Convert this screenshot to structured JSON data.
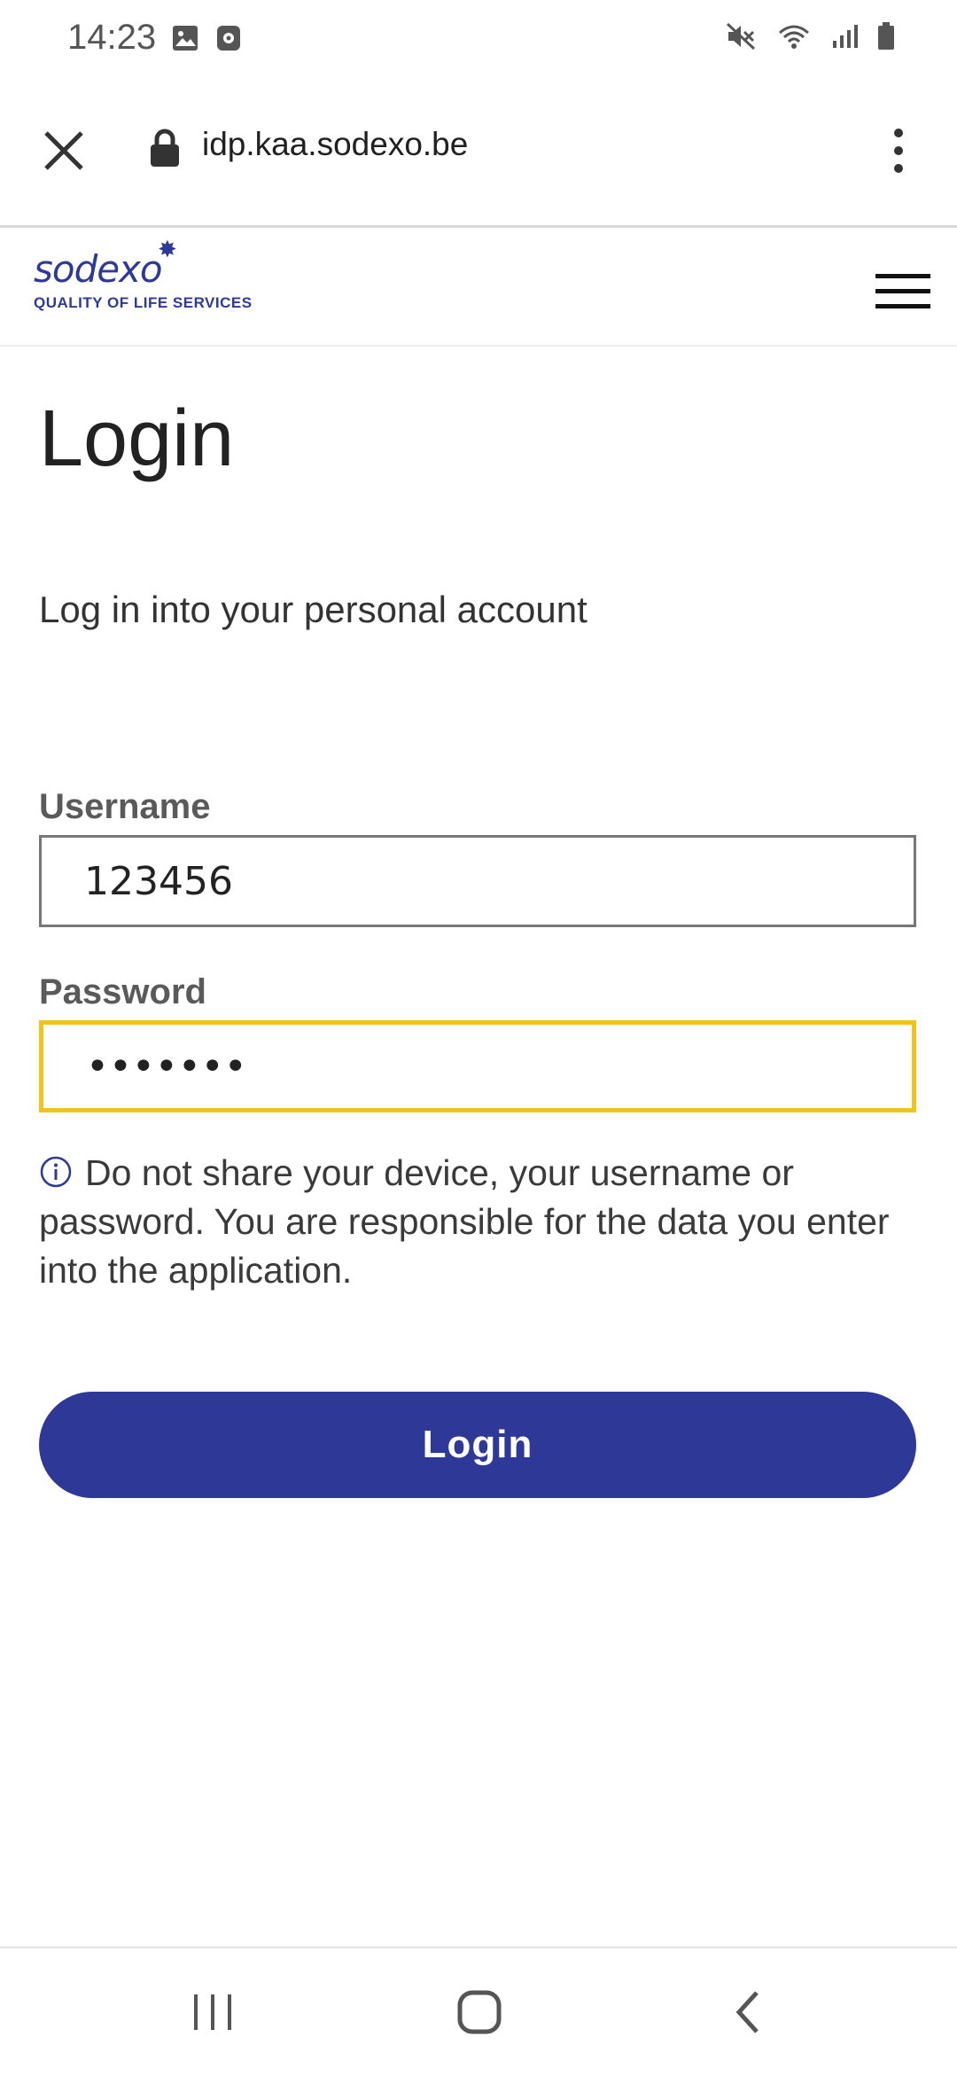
{
  "status_bar": {
    "time": "14:23",
    "left_icons": [
      "image-icon",
      "recorder-icon"
    ],
    "right_icons": [
      "mute-icon",
      "wifi-icon",
      "signal-icon",
      "battery-icon"
    ]
  },
  "browser": {
    "url": "idp.kaa.sodexo.be",
    "icons": [
      "close-icon",
      "lock-icon",
      "more-vert-icon"
    ]
  },
  "site_header": {
    "logo_text": "sodexo",
    "logo_tagline": "QUALITY OF LIFE SERVICES",
    "brand_color": "#2d3a97",
    "menu_icon": "hamburger-icon"
  },
  "login": {
    "title": "Login",
    "subtitle": "Log in into your personal account",
    "username_label": "Username",
    "username_value": "123456",
    "password_label": "Password",
    "password_value": "1234567",
    "notice": "Do not share your device, your username or password. You are responsible for the data you enter into the application.",
    "button_label": "Login",
    "focus_color": "#f0c41b",
    "button_color": "#2e3897"
  },
  "nav_bar": {
    "icons": [
      "recents-icon",
      "home-icon",
      "back-icon"
    ]
  }
}
